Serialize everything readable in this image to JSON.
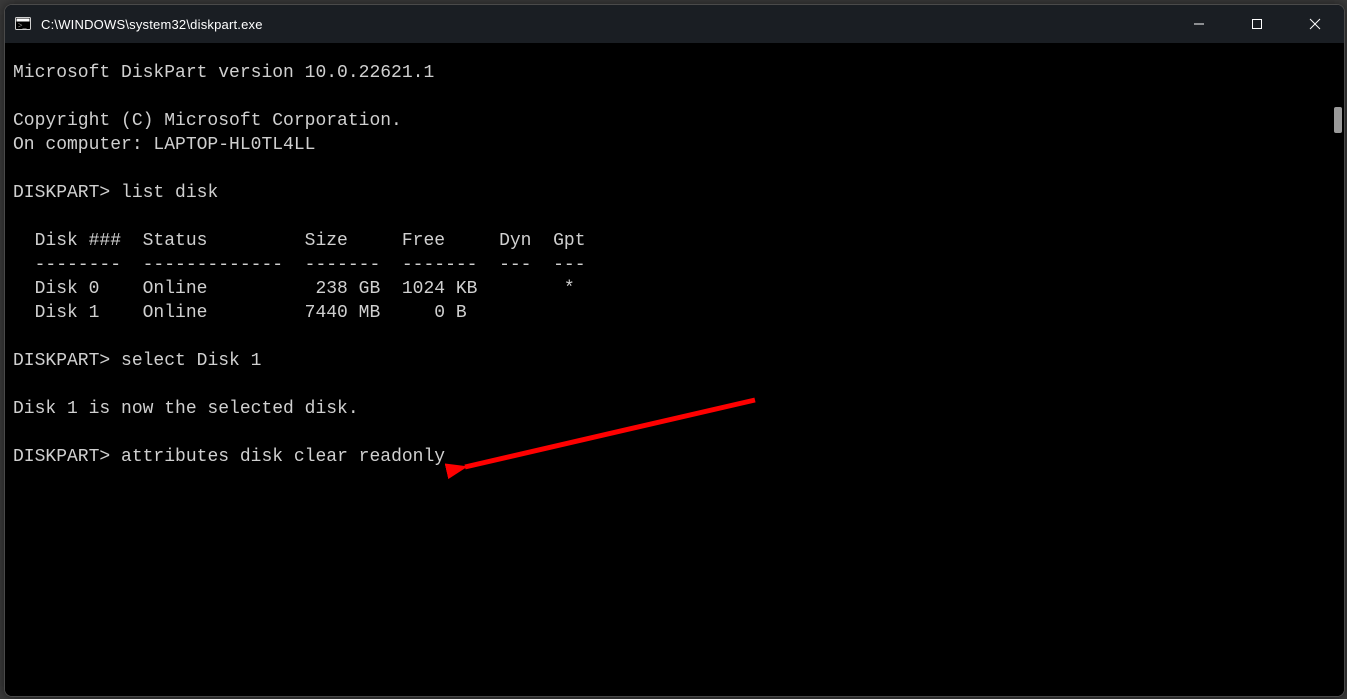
{
  "window": {
    "title": "C:\\WINDOWS\\system32\\diskpart.exe"
  },
  "terminal": {
    "version_line": "Microsoft DiskPart version 10.0.22621.1",
    "copyright_line": "Copyright (C) Microsoft Corporation.",
    "computer_line": "On computer: LAPTOP-HL0TL4LL",
    "prompt": "DISKPART>",
    "cmd_list": "list disk",
    "table_header": "  Disk ###  Status         Size     Free     Dyn  Gpt",
    "table_divider": "  --------  -------------  -------  -------  ---  ---",
    "disks": [
      {
        "row": "  Disk 0    Online          238 GB  1024 KB        *"
      },
      {
        "row": "  Disk 1    Online         7440 MB     0 B"
      }
    ],
    "cmd_select": "select Disk 1",
    "select_response": "Disk 1 is now the selected disk.",
    "cmd_attributes": "attributes disk clear readonly"
  },
  "colors": {
    "fg": "#d0d0d0",
    "bg": "#000000",
    "titlebar": "#1a1e23",
    "arrow": "#fe0000"
  }
}
